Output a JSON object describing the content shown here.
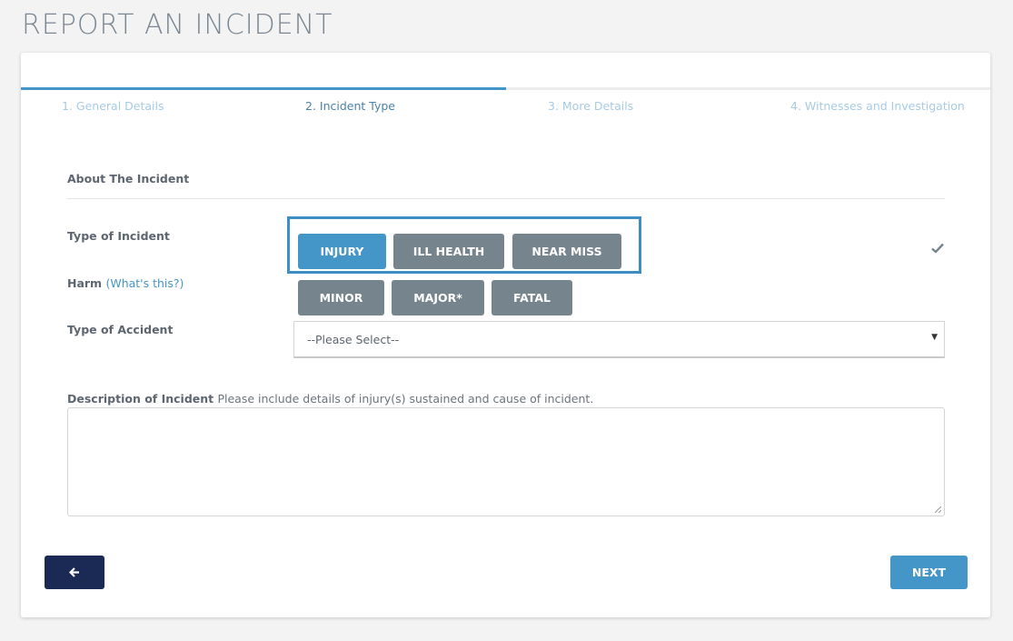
{
  "page_title": "REPORT AN INCIDENT",
  "steps": [
    {
      "label": "1. General Details",
      "active": false
    },
    {
      "label": "2. Incident Type",
      "active": true
    },
    {
      "label": "3. More Details",
      "active": false
    },
    {
      "label": "4. Witnesses and Investigation",
      "active": false
    }
  ],
  "progress_step": 2,
  "progress_total": 4,
  "section_title": "About The Incident",
  "type_of_incident": {
    "label": "Type of Incident",
    "options": [
      "INJURY",
      "ILL HEALTH",
      "NEAR MISS"
    ],
    "selected": "INJURY",
    "complete_icon": "check-icon"
  },
  "harm": {
    "label": "Harm",
    "help_link": "(What's this?)",
    "options": [
      "MINOR",
      "MAJOR*",
      "FATAL"
    ]
  },
  "type_of_accident": {
    "label": "Type of Accident",
    "value": "--Please Select--"
  },
  "description": {
    "label": "Description of Incident",
    "hint": "Please include details of injury(s) sustained and cause of incident.",
    "value": ""
  },
  "buttons": {
    "back_icon": "arrow-left-icon",
    "back_glyph": "🡐",
    "next": "NEXT"
  },
  "colors": {
    "accent": "#4596c8",
    "button_grey": "#76858d",
    "back_button": "#1b2a55",
    "highlight_border": "#3e8ec3"
  }
}
